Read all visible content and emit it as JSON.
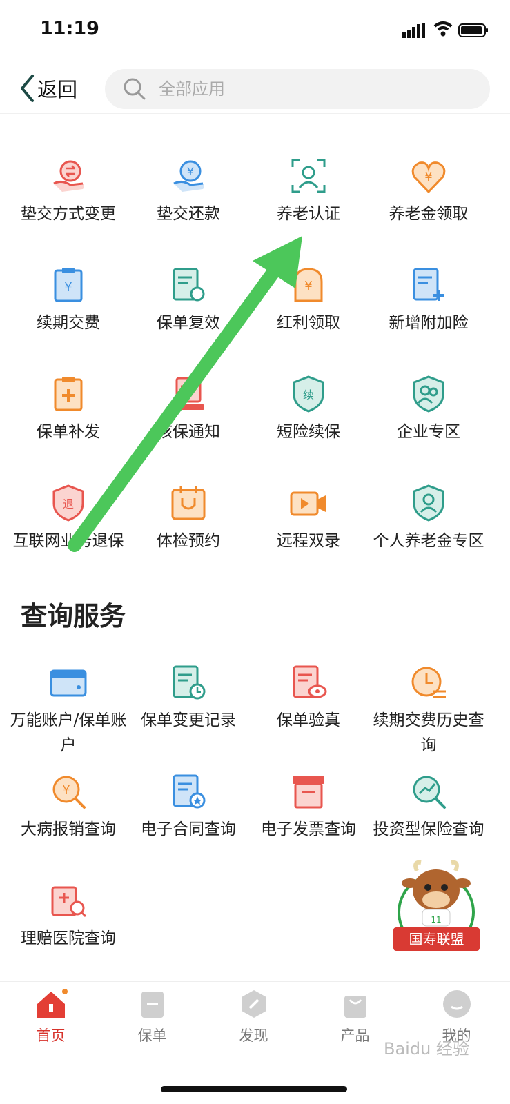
{
  "status": {
    "time": "11:19"
  },
  "header": {
    "back_label": "返回",
    "search_placeholder": "全部应用"
  },
  "services": [
    {
      "label": "垫交方式变更",
      "icon": "swap-payment-icon"
    },
    {
      "label": "垫交还款",
      "icon": "repay-icon"
    },
    {
      "label": "养老认证",
      "icon": "face-scan-icon"
    },
    {
      "label": "养老金领取",
      "icon": "heart-yuan-icon"
    },
    {
      "label": "续期交费",
      "icon": "clipboard-yuan-icon"
    },
    {
      "label": "保单复效",
      "icon": "doc-refresh-icon"
    },
    {
      "label": "红利领取",
      "icon": "tombstone-yuan-icon"
    },
    {
      "label": "新增附加险",
      "icon": "doc-plus-icon"
    },
    {
      "label": "保单补发",
      "icon": "clipboard-plus-icon"
    },
    {
      "label": "核保通知",
      "icon": "doc-stamp-icon"
    },
    {
      "label": "短险续保",
      "icon": "shield-renew-icon"
    },
    {
      "label": "企业专区",
      "icon": "shield-people-icon"
    },
    {
      "label": "互联网业务退保",
      "icon": "shield-return-icon"
    },
    {
      "label": "体检预约",
      "icon": "calendar-stethoscope-icon"
    },
    {
      "label": "远程双录",
      "icon": "video-icon"
    },
    {
      "label": "个人养老金专区",
      "icon": "shield-person-icon"
    }
  ],
  "query_section_title": "查询服务",
  "queries": [
    {
      "label": "万能账户/保单账户",
      "icon": "wallet-icon"
    },
    {
      "label": "保单变更记录",
      "icon": "doc-clock-icon"
    },
    {
      "label": "保单验真",
      "icon": "doc-eye-icon"
    },
    {
      "label": "续期交费历史查询",
      "icon": "clock-exchange-icon"
    },
    {
      "label": "大病报销查询",
      "icon": "magnifier-yuan-icon"
    },
    {
      "label": "电子合同查询",
      "icon": "doc-star-icon"
    },
    {
      "label": "电子发票查询",
      "icon": "invoice-box-icon"
    },
    {
      "label": "投资型保险查询",
      "icon": "magnifier-chart-icon"
    },
    {
      "label": "理赔医院查询",
      "icon": "hospital-search-icon"
    }
  ],
  "mascot": {
    "badge": "国寿联盟"
  },
  "tabs": [
    {
      "label": "首页",
      "icon": "home-icon",
      "active": true
    },
    {
      "label": "保单",
      "icon": "policy-icon"
    },
    {
      "label": "发现",
      "icon": "discover-icon"
    },
    {
      "label": "产品",
      "icon": "product-bag-icon"
    },
    {
      "label": "我的",
      "icon": "profile-icon"
    }
  ],
  "watermark": "Baidu 经验",
  "colors": {
    "red": "#e8564f",
    "blue": "#3a8fe0",
    "teal": "#2f9d8b",
    "orange": "#f08a2c",
    "arrow": "#4cc75a",
    "active_tab": "#d7322b"
  }
}
